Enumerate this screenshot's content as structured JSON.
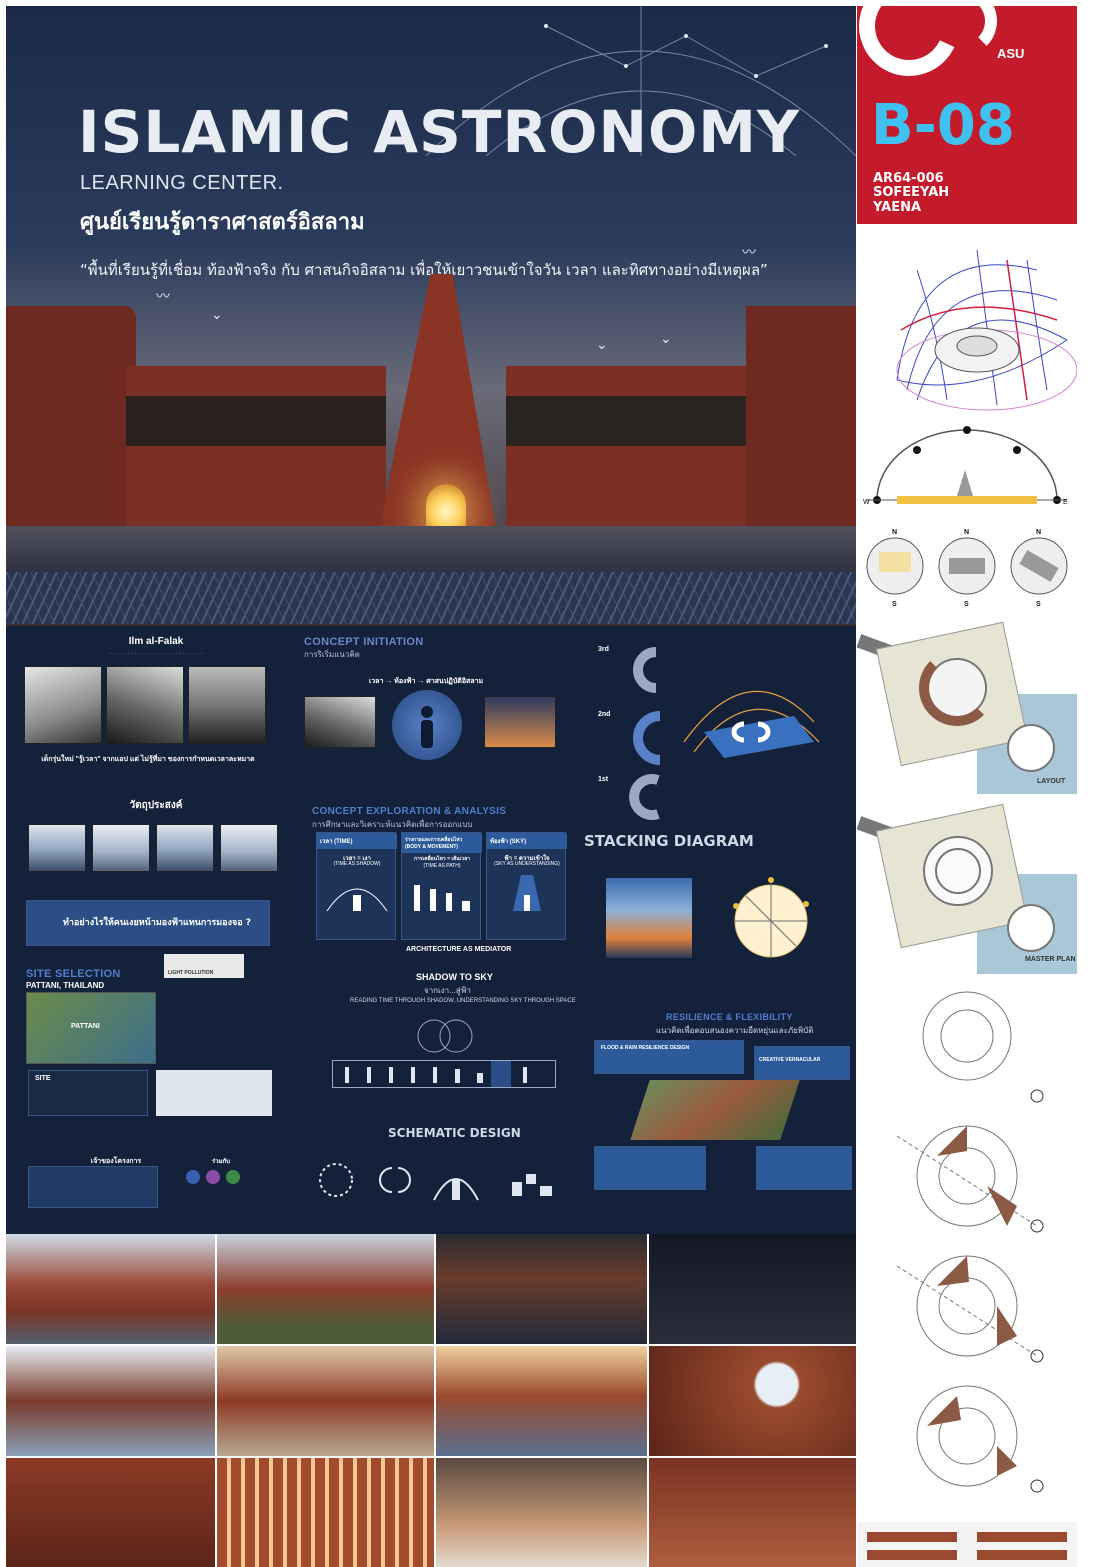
{
  "header": {
    "title": "ISLAMIC ASTRONOMY",
    "subtitle": "LEARNING CENTER.",
    "thai_title": "ศูนย์เรียนรู้ดาราศาสตร์อิสลาม",
    "tagline": "“พื้นที่เรียนรู้ที่เชื่อม ท้องฟ้าจริง กับ ศาสนกิจอิสลาม เพื่อให้เยาวชนเข้าใจวัน เวลา และทิศทางอย่างมีเหตุผล”"
  },
  "badge": {
    "logo_text": "ASU",
    "code": "B-08",
    "id_lines": [
      "AR64-006",
      "SOFEEYAH",
      "YAENA"
    ]
  },
  "sections": {
    "ilm_title": "Ilm al-Falak",
    "problem_head": "เด็กรุ่นใหม่ \"รู้เวลา\" จากแอป แต่ ไม่รู้ที่มา ของการกำหนดเวลาละหมาด",
    "objective_title": "วัตถุประสงค์",
    "question": "ทำอย่างไรให้คนเงยหน้ามองฟ้าแทนการมองจอ ?",
    "site_selection": "SITE SELECTION",
    "site_location": "PATTANI, THAILAND",
    "site_label": "SITE",
    "light_pollution": "LIGHT POLLUTION",
    "pattani": "PATTANI",
    "owner_title": "เจ้าของโครงการ",
    "partners_title": "ร่วมกับ",
    "concept_initiation": "CONCEPT INITIATION",
    "concept_initiation_th": "การริเริ่มแนวคิด",
    "concept_formula": "เวลา → ท้องฟ้า → ศาสนปฏิบัติอิสลาม",
    "concept_exploration": "CONCEPT EXPLORATION & ANALYSIS",
    "concept_exploration_th": "การศึกษาและวิเคราะห์แนวคิดเพื่อการออกแบบ",
    "columns": [
      {
        "head": "เวลา (TIME)",
        "formula": "เวลา = เงา",
        "en": "(TIME AS SHADOW)"
      },
      {
        "head": "ร่างกายและการเคลื่อนไหว (BODY & MOVEMENT)",
        "formula": "การเคลื่อนไหว = เส้นเวลา",
        "en": "(TIME AS PATH)"
      },
      {
        "head": "ท้องฟ้า (SKY)",
        "formula": "ฟ้า = ความเข้าใจ",
        "en": "(SKY AS UNDERSTANDING)"
      }
    ],
    "arch_mediator": "ARCHITECTURE AS MEDIATOR",
    "shadow_to_sky": "SHADOW TO SKY",
    "shadow_to_sky_th": "จากเงา...สู่ฟ้า",
    "reading_time": "READING TIME THROUGH SHADOW, UNDERSTANDING SKY THROUGH SPACE",
    "schematic": "SCHEMATIC DESIGN",
    "stacking": "STACKING DIAGRAM",
    "floors": [
      "3rd",
      "2nd",
      "1st"
    ],
    "resilience": "RESILIENCE & FLEXIBILITY",
    "resilience_th": "แนวคิดเพื่อตอบสนองความยืดหยุ่นและภัยพิบัติ",
    "flood": "FLOOD & RAIN RESILIENCE DESIGN",
    "vernacular": "CREATIVE VERNACULAR"
  },
  "right_column": {
    "compass": [
      "N",
      "S",
      "W",
      "E"
    ],
    "layout_label": "LAYOUT",
    "master_plan_label": "MASTER PLAN"
  },
  "colors": {
    "poster_bg": "#13213a",
    "badge_red": "#c41b2c",
    "badge_code": "#3fc1f0",
    "accent_blue": "#6a86c8"
  }
}
